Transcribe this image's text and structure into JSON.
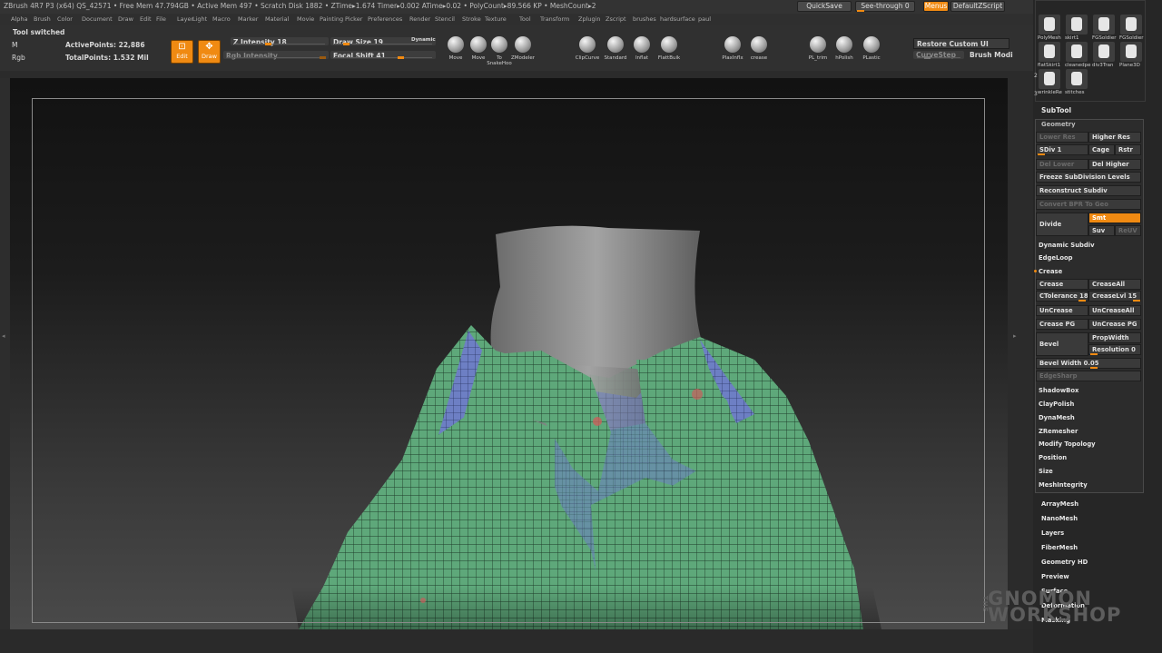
{
  "titlebar": {
    "text": "ZBrush 4R7 P3 (x64)   QS_42571   • Free Mem 47.794GB • Active Mem 497 • Scratch Disk 1882 • ZTime▸1.674 Timer▸0.002 ATime▸0.02 • PolyCount▸89.566 KP • MeshCount▸2",
    "quicksave": "QuickSave",
    "see_through": "See-through  0",
    "menus": "Menus",
    "zscript": "DefaultZScript"
  },
  "menubar": [
    "Alpha",
    "Brush",
    "Color",
    "Document",
    "Draw",
    "Edit",
    "File",
    "Layer",
    "Light",
    "Macro",
    "Marker",
    "Material",
    "Movie",
    "Painting",
    "Picker",
    "Preferences",
    "Render",
    "Stencil",
    "Stroke",
    "Texture",
    "Tool",
    "Transform",
    "Zplugin",
    "Zscript",
    "brushes",
    "hardsurface",
    "paul"
  ],
  "info": {
    "status": "Tool switched",
    "m": "M",
    "rgb": "Rgb",
    "active_points": "ActivePoints: 22,886",
    "total_points": "TotalPoints: 1.532 Mil"
  },
  "toolbar": {
    "edit": "Edit",
    "draw": "Draw",
    "z_intensity": "Z Intensity 18",
    "rgb_intensity": "Rgb Intensity",
    "draw_size": "Draw Size 19",
    "dynamic": "Dynamic",
    "focal_shift": "Focal Shift 41",
    "restore_ui": "Restore Custom UI",
    "curve_step": "CurveStep",
    "brush_mode": "Brush Modi"
  },
  "brushes": [
    {
      "label": "Move"
    },
    {
      "label": "Move"
    },
    {
      "label": "To SnakeHoo"
    },
    {
      "label": "ZModeler"
    },
    {
      "label": "ClipCurve"
    },
    {
      "label": "Standard"
    },
    {
      "label": "Inflat"
    },
    {
      "label": "FlattBuik"
    },
    {
      "label": "PlaxInflx"
    },
    {
      "label": "crease"
    },
    {
      "label": "PL_trim"
    },
    {
      "label": "hPolish"
    },
    {
      "label": "PLastic"
    }
  ],
  "subtool_thumbs": [
    {
      "label": "PolyMesh"
    },
    {
      "label": "skirt1"
    },
    {
      "label": "FGSoldier"
    },
    {
      "label": "FGSoldier"
    },
    {
      "label": "flatSkirt1"
    },
    {
      "label": "cleanedpe"
    },
    {
      "label": "div3Tran"
    },
    {
      "label": "Plane3D"
    },
    {
      "label": "wrinkleRe"
    },
    {
      "label": "stitches"
    }
  ],
  "thumb_numbers": [
    "3",
    "2"
  ],
  "right_panel": {
    "subtool": "SubTool",
    "geometry": "Geometry",
    "lower_res": "Lower Res",
    "higher_res": "Higher Res",
    "sdiv": "SDiv 1",
    "cage": "Cage",
    "rstr": "Rstr",
    "del_lower": "Del Lower",
    "del_higher": "Del Higher",
    "freeze": "Freeze SubDivision Levels",
    "reconstruct": "Reconstruct Subdiv",
    "convert_bpr": "Convert BPR To Geo",
    "divide": "Divide",
    "smt": "Smt",
    "suv": "Suv",
    "rsuv": "ReUV",
    "dynamic_subdiv": "Dynamic Subdiv",
    "edgeloop": "EdgeLoop",
    "crease_header": "Crease",
    "crease": "Crease",
    "crease_all": "CreaseAll",
    "ctolerance": "CTolerance 180",
    "crease_lvl": "CreaseLvl 15",
    "uncrease": "UnCrease",
    "uncrease_all": "UnCreaseAll",
    "crease_pg": "Crease PG",
    "uncrease_pg": "UnCrease PG",
    "bevel": "Bevel",
    "propwidth": "PropWidth",
    "resolution": "Resolution 0",
    "bevel_width": "Bevel Width 0.05",
    "edgesharp": "EdgeSharp",
    "shadowbox": "ShadowBox",
    "claypolish": "ClayPolish",
    "dynamesh": "DynaMesh",
    "zremesher": "ZRemesher",
    "modify_topology": "Modify Topology",
    "position": "Position",
    "size": "Size",
    "meshintegrity": "MeshIntegrity",
    "arraymesh": "ArrayMesh",
    "nanomesh": "NanoMesh",
    "layers": "Layers",
    "fibermesh": "FiberMesh",
    "geometry_hd": "Geometry HD",
    "preview": "Preview",
    "surface": "Surface",
    "deformation": "Deformation",
    "masking": "Masking"
  },
  "watermark": {
    "the": "THE",
    "line1": "GNOMON",
    "line2": "WORKSHOP"
  },
  "colors": {
    "accent": "#f08a12",
    "mesh_green": "#5ea87a",
    "mesh_blue": "#6d7fc4",
    "neck_grey": "#8c8c8c"
  }
}
